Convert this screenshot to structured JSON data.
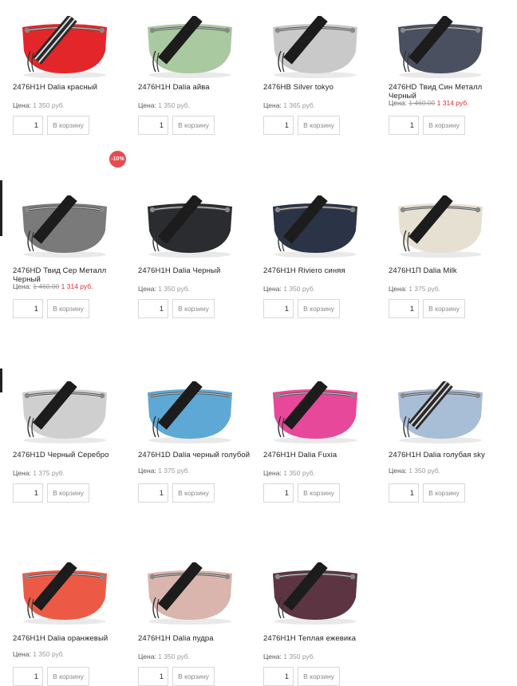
{
  "badge": {
    "discount_label": "-10%"
  },
  "price_label": "Цена:",
  "cart_label": "В корзину",
  "products": [
    {
      "name": "2476H1H Dalia красный",
      "price": "1 350 руб.",
      "old_price": "",
      "qty": "1",
      "body_color": "#e2262a",
      "strap": "striped"
    },
    {
      "name": "2476H1H Dalia айва",
      "price": "1 350 руб.",
      "old_price": "",
      "qty": "1",
      "body_color": "#a9c9a0",
      "strap": "black"
    },
    {
      "name": "2476HB Silver tokyo",
      "price": "1 365 руб.",
      "old_price": "",
      "qty": "1",
      "body_color": "#c9c9c9",
      "strap": "black"
    },
    {
      "name": "2476HD Твид Син Металл Черный",
      "price": "1 314 руб.",
      "old_price": "1 460.00",
      "qty": "1",
      "body_color": "#4a5060",
      "strap": "black"
    },
    {
      "name": "2476HD Твид Сер Металл Черный",
      "price": "1 314 руб.",
      "old_price": "1 460.00",
      "qty": "1",
      "body_color": "#7a7a7a",
      "strap": "black"
    },
    {
      "name": "2476H1H Dalia Черный",
      "price": "1 350 руб.",
      "old_price": "",
      "qty": "1",
      "body_color": "#2a2c30",
      "strap": "black"
    },
    {
      "name": "2476H1H Riviero синяя",
      "price": "1 350 руб.",
      "old_price": "",
      "qty": "1",
      "body_color": "#2b3346",
      "strap": "black"
    },
    {
      "name": "2476H1П Dalia Milk",
      "price": "1 375 руб.",
      "old_price": "",
      "qty": "1",
      "body_color": "#e6e0d2",
      "strap": "black"
    },
    {
      "name": "2476H1D Черный Серебро",
      "price": "1 375 руб.",
      "old_price": "",
      "qty": "1",
      "body_color": "#cfcfcf",
      "strap": "black"
    },
    {
      "name": "2476H1D Dalia черный голубой",
      "price": "1 375 руб.",
      "old_price": "",
      "qty": "1",
      "body_color": "#5ea8d6",
      "strap": "black"
    },
    {
      "name": "2476H1H Dalia Fuxia",
      "price": "1 350 руб.",
      "old_price": "",
      "qty": "1",
      "body_color": "#e8489a",
      "strap": "black"
    },
    {
      "name": "2476H1H Dalia голубая sky",
      "price": "1 350 руб.",
      "old_price": "",
      "qty": "1",
      "body_color": "#a8bdd6",
      "strap": "striped"
    },
    {
      "name": "2476H1H Dalia оранжевый",
      "price": "1 350 руб.",
      "old_price": "",
      "qty": "1",
      "body_color": "#ec5a45",
      "strap": "black"
    },
    {
      "name": "2476H1H Dalia пудра",
      "price": "1 350 руб.",
      "old_price": "",
      "qty": "1",
      "body_color": "#d9b5ae",
      "strap": "black"
    },
    {
      "name": "2476H1H Теплая ежевика",
      "price": "1 350 руб.",
      "old_price": "",
      "qty": "1",
      "body_color": "#5d3442",
      "strap": "black"
    }
  ]
}
